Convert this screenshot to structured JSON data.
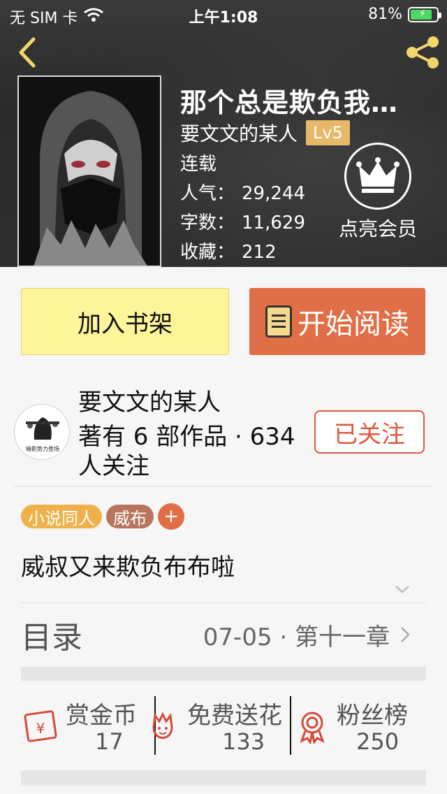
{
  "status_bar": {
    "carrier": "无 SIM 卡",
    "time": "上午1:08",
    "battery": "81%"
  },
  "book": {
    "title": "那个总是欺负我…",
    "author": "要文文的某人",
    "level": "Lv5",
    "status": "连载",
    "stats": [
      {
        "label": "人气：",
        "value": "29,244"
      },
      {
        "label": "字数：",
        "value": "11,629"
      },
      {
        "label": "收藏：",
        "value": "212"
      }
    ],
    "vip_label": "点亮会员"
  },
  "actions": {
    "add_shelf": "加入书架",
    "start_reading": "开始阅读"
  },
  "author_card": {
    "name": "要文文的某人",
    "meta": "著有 6 部作品 · 634 人关注",
    "avatar_caption": "暗影势力登场",
    "follow_button": "已关注"
  },
  "tags": [
    "小说同人",
    "威布"
  ],
  "tag_add": "+",
  "summary": "威叔又来欺负布布啦",
  "toc": {
    "label": "目录",
    "latest": "07-05 · 第十一章"
  },
  "rewards": [
    {
      "label": "赏金币",
      "value": "17",
      "icon": "red-envelope-icon"
    },
    {
      "label": "免费送花",
      "value": "133",
      "icon": "flower-icon"
    },
    {
      "label": "粉丝榜",
      "value": "250",
      "icon": "medal-icon"
    }
  ],
  "colors": {
    "accent_orange": "#e06f47",
    "shelf_yellow": "#fcf59a",
    "gold_badge": "#e7b76a",
    "follow_red": "#e0583d"
  }
}
